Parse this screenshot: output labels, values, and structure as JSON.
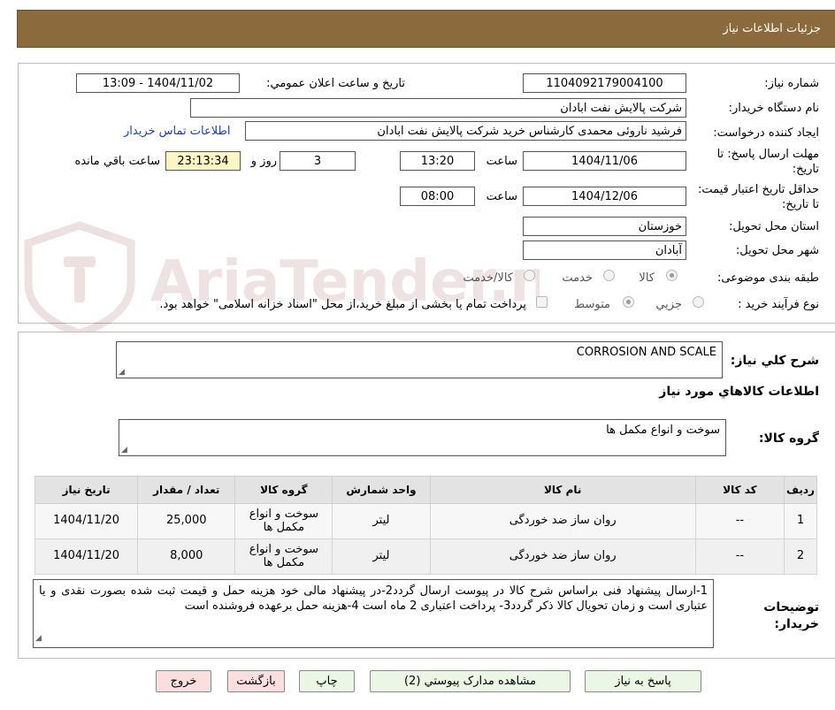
{
  "header": {
    "title": "جزئیات اطلاعات نیاز"
  },
  "watermark": {
    "text": "AriaTender.neT"
  },
  "fields": {
    "need_number_label": "شماره نیاز:",
    "need_number": "1104092179004100",
    "announce_label": "تاریخ و ساعت اعلان عمومي:",
    "announce_value": "1404/11/02 - 13:09",
    "buyer_org_label": "نام دستگاه خريدار:",
    "buyer_org": "شرکت پالايش نفت ابادان",
    "creator_label": "ايجاد کننده درخواست:",
    "creator": "فرشيد ناروئی محمدی کارشناس خريد  شرکت پالايش نفت ابادان",
    "contact_link": "اطلاعات تماس خريدار",
    "deadline_label": "مهلت ارسال پاسخ: تا تاريخ:",
    "deadline_date": "1404/11/06",
    "time_label": "ساعت",
    "deadline_time": "13:20",
    "days_value": "3",
    "days_label": "روز و",
    "remaining_value": "23:13:34",
    "remaining_label": "ساعت باقي مانده",
    "validity_label": "حداقل تاريخ اعتبار قيمت: تا تاريخ:",
    "validity_date": "1404/12/06",
    "validity_time": "08:00",
    "province_label": "استان محل تحويل:",
    "province": "خوزستان",
    "city_label": "شهر محل تحويل:",
    "city": "آبادان",
    "category_label": "طبقه بندی موضوعی:",
    "category_options": [
      "کالا",
      "خدمت",
      "کالا/خدمت"
    ],
    "process_label": "نوع فرآيند خريد :",
    "process_options": [
      "جزيي",
      "متوسط"
    ],
    "payment_note": "پرداخت تمام يا بخشی از مبلغ خريد،از محل \"اسناد خزانه اسلامی\" خواهد بود."
  },
  "summary": {
    "label": "شرح کلي نياز:",
    "value": "CORROSION AND SCALE",
    "goods_title": "اطلاعات کالاهاي مورد نياز",
    "group_label": "گروه کالا:",
    "group_value": "سوخت و انواع مکمل ها"
  },
  "table": {
    "headers": [
      "رديف",
      "کد کالا",
      "نام کالا",
      "واحد شمارش",
      "گروه کالا",
      "تعداد / مقدار",
      "تاريخ نياز"
    ],
    "rows": [
      [
        "1",
        "--",
        "روان ساز ضد خوردگی",
        "ليتر",
        "سوخت و انواع مکمل ها",
        "25,000",
        "1404/11/20"
      ],
      [
        "2",
        "--",
        "روان ساز ضد خوردگی",
        "ليتر",
        "سوخت و انواع مکمل ها",
        "8,000",
        "1404/11/20"
      ]
    ]
  },
  "notes": {
    "label": "توضيحات خريدار:",
    "value": "1-ارسال پيشنهاد فنی براساس شرح کالا در پيوست ارسال گردد2-در پيشنهاد مالی خود هزينه حمل و قيمت ثبت شده بصورت نقدی و يا عتباری است و زمان تحويال کالا ذکر گردد3- پرداخت اعتباری 2 ماه است 4-هزينه حمل برعهده فروشنده است"
  },
  "buttons": {
    "reply": "پاسخ به نياز",
    "attachments": "مشاهده مدارک پيوستي (2)",
    "print": "چاپ",
    "back": "بازگشت",
    "exit": "خروج"
  }
}
